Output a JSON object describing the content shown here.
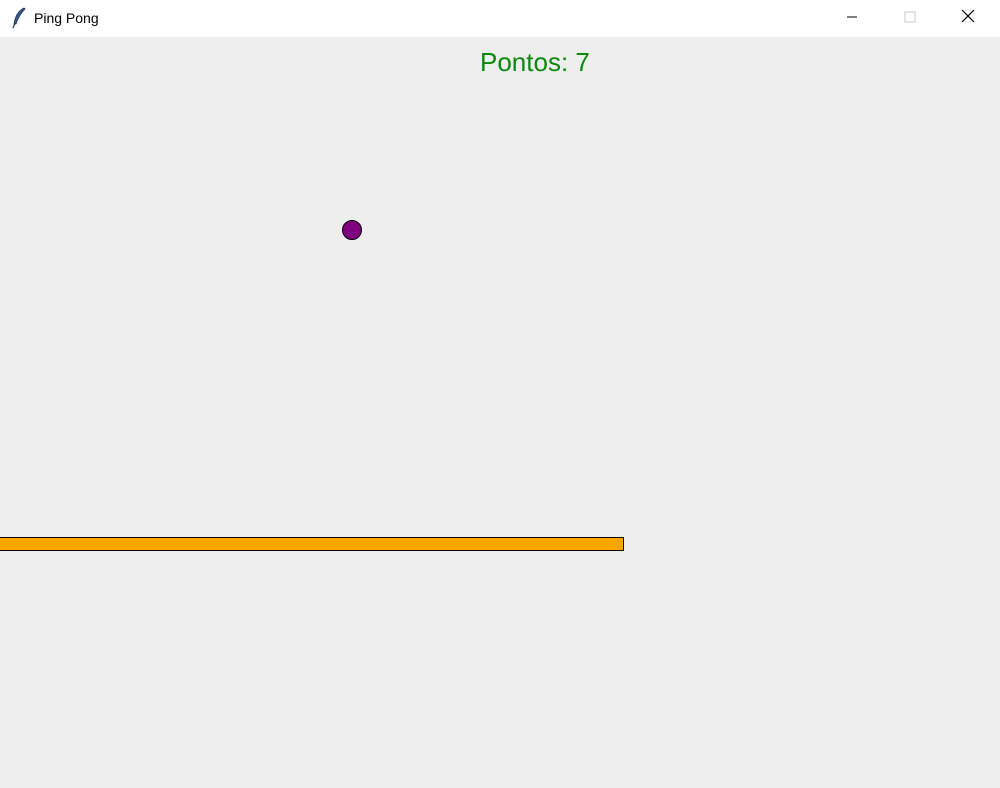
{
  "window": {
    "title": "Ping Pong",
    "app_icon": "feather-icon",
    "controls": [
      "minimize-icon",
      "maximize-icon",
      "close-icon"
    ]
  },
  "game": {
    "score_text": "Pontos: 7",
    "score_color": "#0a8a0a",
    "background_color": "#eeeeee",
    "ball_color": "#800080",
    "paddle_color": "#ffa500"
  }
}
